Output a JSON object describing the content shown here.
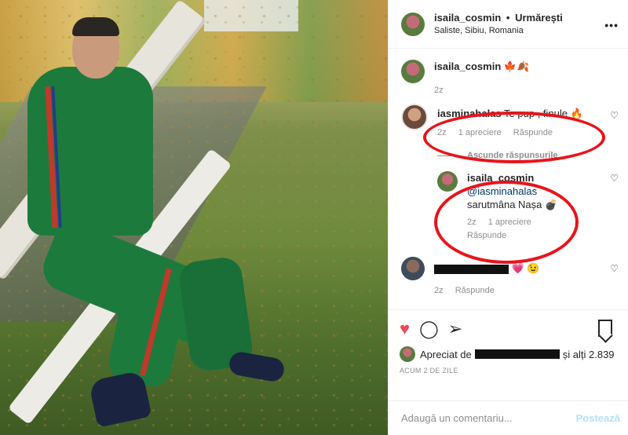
{
  "header": {
    "username": "isaila_cosmin",
    "separator": "•",
    "follow_label": "Urmărești",
    "location": "Saliste, Sibiu, Romania",
    "more": "•••"
  },
  "caption": {
    "username": "isaila_cosmin",
    "text": "🍁🍂",
    "time": "2z"
  },
  "comments": [
    {
      "username": "iasminahalas",
      "text": "Te pup , finule 🔥",
      "time": "2z",
      "likes": "1 apreciere",
      "reply_label": "Răspunde"
    }
  ],
  "hide_replies": "Ascunde răspunsurile",
  "reply": {
    "username": "isaila_cosmin",
    "mention": "@iasminahalas",
    "text": "sarutmâna Nașa 💣",
    "time": "2z",
    "likes": "1 apreciere",
    "reply_label": "Răspunde"
  },
  "third_comment": {
    "text_tail": "💗 😉",
    "time": "2z",
    "reply_label": "Răspunde"
  },
  "likes_summary": {
    "prefix": "Apreciat de",
    "suffix": "și alți 2.839"
  },
  "date": "ACUM 2 DE ZILE",
  "add_comment": {
    "placeholder": "Adaugă un comentariu...",
    "post_label": "Postează"
  },
  "colors": {
    "like_red": "#ed4956",
    "annotation_red": "#e8141c",
    "post_disabled": "#b2dffc"
  }
}
